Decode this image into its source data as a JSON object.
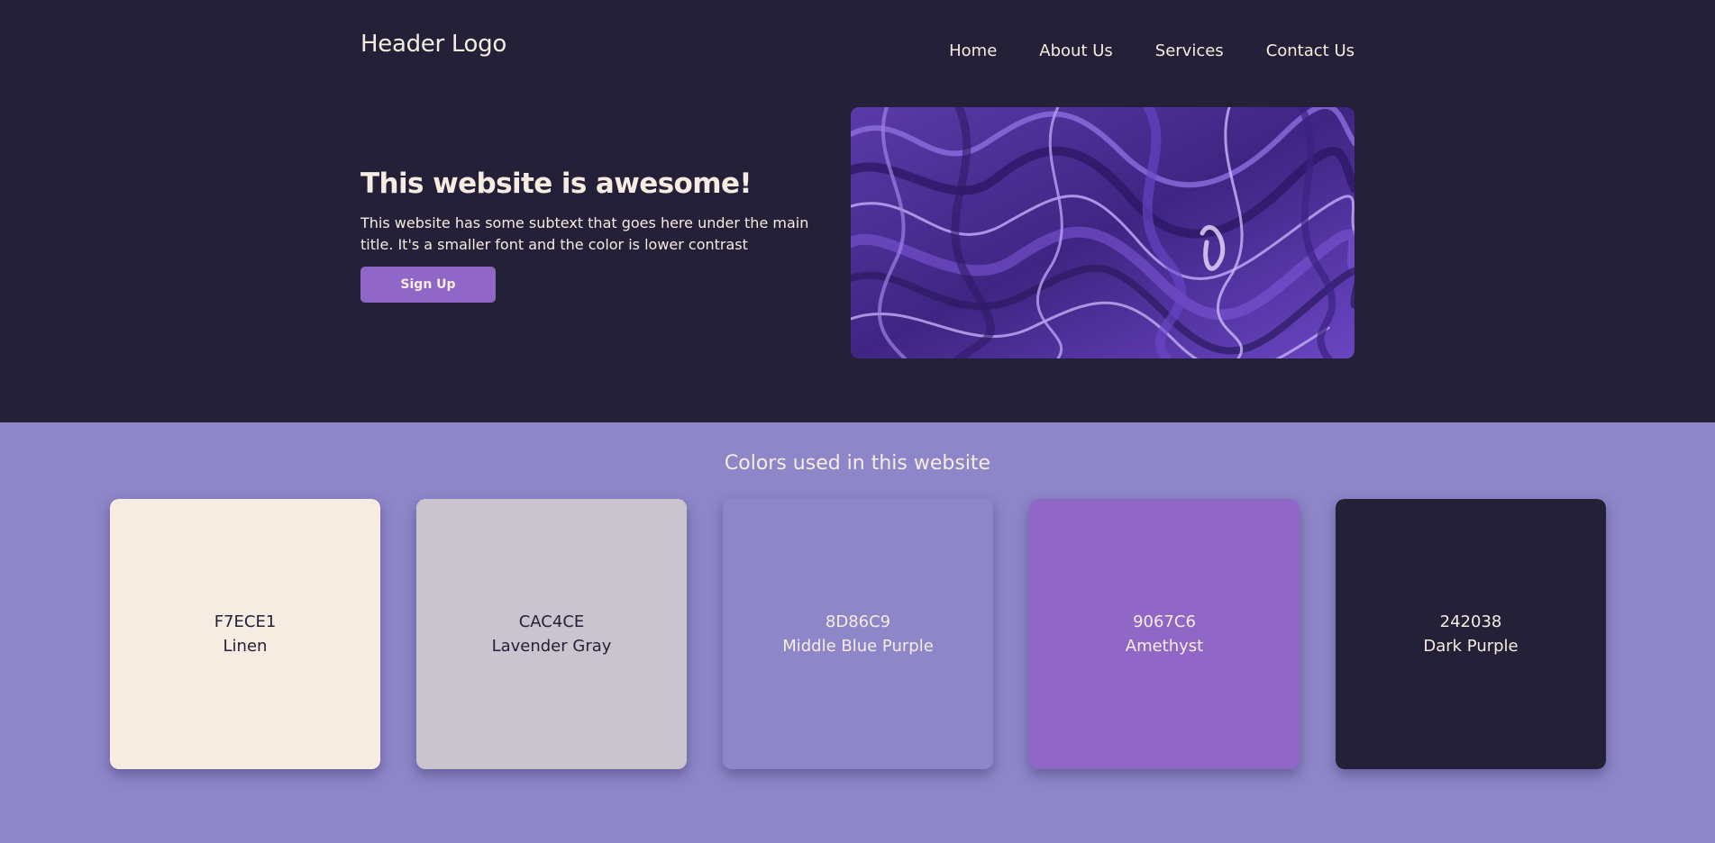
{
  "header": {
    "logo": "Header Logo",
    "nav": [
      "Home",
      "About Us",
      "Services",
      "Contact Us"
    ]
  },
  "hero": {
    "title": "This website is awesome!",
    "subtext": "This website has some subtext that goes here under the main title. It's a smaller font and the color is lower contrast",
    "button_label": "Sign Up",
    "image_description_icon": "purple-marble-image"
  },
  "palette": {
    "title": "Colors used in this website",
    "colors": [
      {
        "hex": "F7ECE1",
        "name": "Linen",
        "bg": "#F7ECE1",
        "text_color": "#242038"
      },
      {
        "hex": "CAC4CE",
        "name": "Lavender Gray",
        "bg": "#CAC4CE",
        "text_color": "#242038"
      },
      {
        "hex": "8D86C9",
        "name": "Middle Blue Purple",
        "bg": "#8D86C9",
        "text_color": "#F7ECE1"
      },
      {
        "hex": "9067C6",
        "name": "Amethyst",
        "bg": "#9067C6",
        "text_color": "#F7ECE1"
      },
      {
        "hex": "242038",
        "name": "Dark Purple",
        "bg": "#242038",
        "text_color": "#F7ECE1"
      }
    ]
  }
}
